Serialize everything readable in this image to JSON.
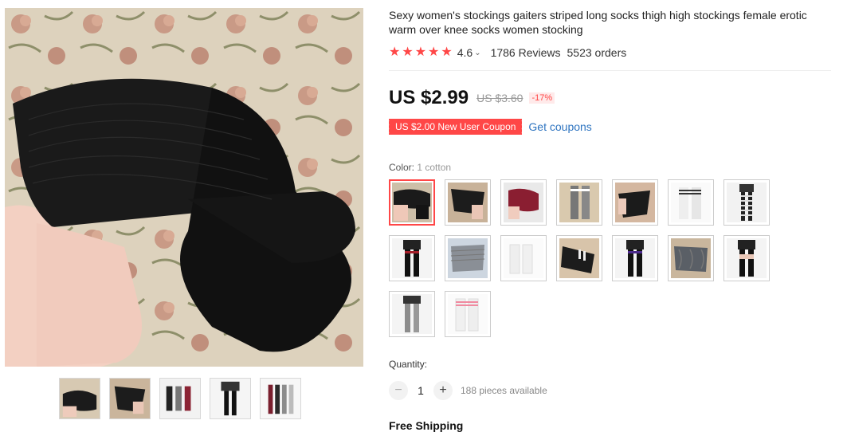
{
  "product": {
    "title": "Sexy women's stockings gaiters striped long socks thigh high stockings female erotic warm over knee socks women stocking",
    "rating": "4.6",
    "reviews": "1786 Reviews",
    "orders": "5523 orders",
    "star_glyph": "★"
  },
  "price": {
    "current": "US $2.99",
    "original": "US $3.60",
    "discount": "-17%"
  },
  "coupon": {
    "label": "US $2.00 New User Coupon",
    "link": "Get coupons"
  },
  "color": {
    "label": "Color:",
    "selected_value": "1 cotton",
    "options": [
      "black-ribbed",
      "black-bow",
      "burgundy",
      "grey-stripe-top",
      "black-over-knee",
      "white-stripe",
      "black-white-stripe",
      "black-red-band",
      "grey-ribbed",
      "white-plain",
      "black-white-stripe-top",
      "black-purple-band",
      "grey-cable",
      "black-lace",
      "grey-plain",
      "white-pink-stripe"
    ]
  },
  "quantity": {
    "label": "Quantity:",
    "minus": "−",
    "value": "1",
    "plus": "+",
    "available": "188 pieces available"
  },
  "shipping": {
    "label": "Free Shipping"
  },
  "colors": {
    "accent": "#ff4747",
    "link": "#2e74c0"
  }
}
